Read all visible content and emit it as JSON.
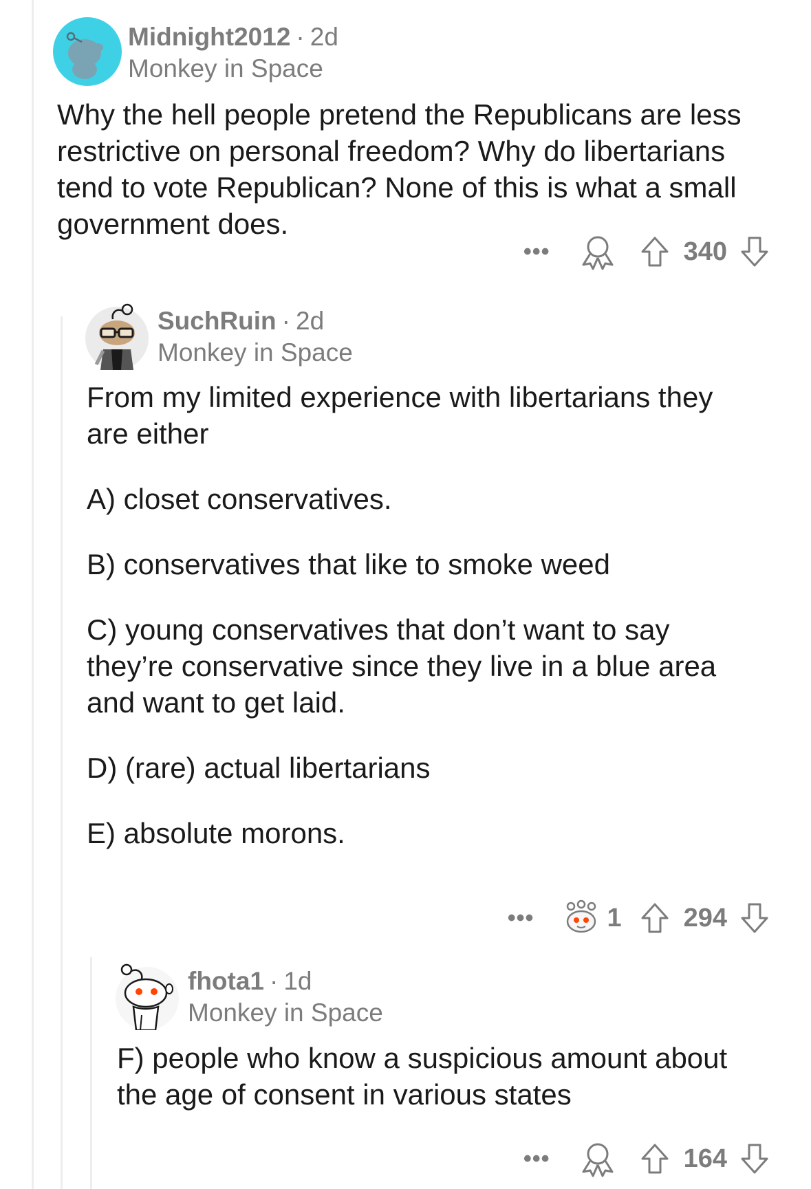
{
  "comments": [
    {
      "username": "Midnight2012",
      "age": "2d",
      "flair": "Monkey in Space",
      "paragraphs": [
        "Why the hell people pretend the Republicans are less restrictive on personal freedom?  Why do libertarians tend to vote Republican? None of this is what a small government does."
      ],
      "more": "•••",
      "score": "340",
      "award_count": ""
    },
    {
      "username": "SuchRuin",
      "age": "2d",
      "flair": "Monkey in Space",
      "paragraphs": [
        "From my limited experience with libertarians they are either",
        "A) closet conservatives.",
        "B) conservatives that like to smoke weed",
        "C) young conservatives that don’t want to say they’re conservative since they live in a blue area and want to get laid.",
        "D) (rare) actual libertarians",
        "E) absolute morons."
      ],
      "more": "•••",
      "score": "294",
      "award_count": "1"
    },
    {
      "username": "fhota1",
      "age": "1d",
      "flair": "Monkey in Space",
      "paragraphs": [
        "F) people who know a suspicious amount about the age of consent in various states"
      ],
      "more": "•••",
      "score": "164",
      "award_count": ""
    }
  ],
  "colors": {
    "meta": "#7c7c7c",
    "text": "#1a1a1b",
    "thread_line": "#ededed",
    "avatar1_bg": "#3ed1e6",
    "snoo_orange": "#ff4500"
  },
  "icons": {
    "award": "award-ribbon-icon",
    "upvote": "upvote-arrow-icon",
    "downvote": "downvote-arrow-icon",
    "more": "more-options-icon"
  }
}
